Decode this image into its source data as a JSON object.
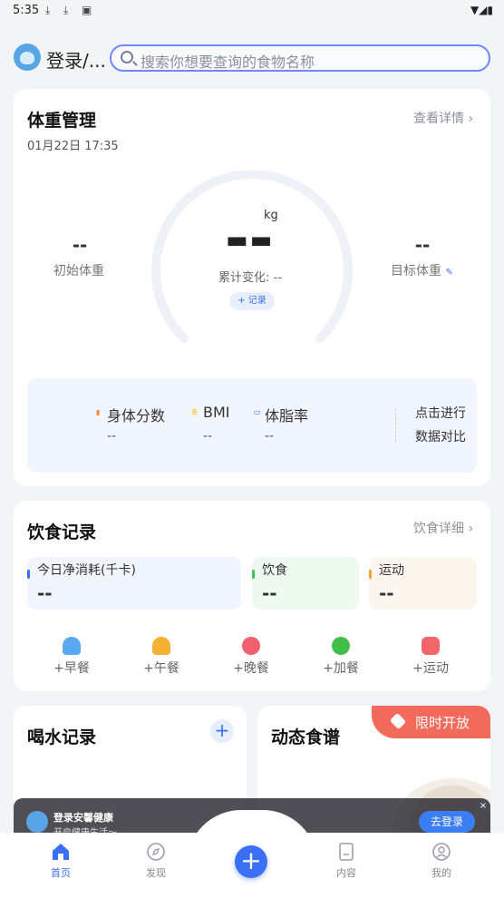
{
  "status_bar": {
    "time": "5:35"
  },
  "header": {
    "login_label": "登录/...",
    "search_placeholder": "搜索你想要查询的食物名称"
  },
  "weight_card": {
    "title": "体重管理",
    "detail_link": "查看详情",
    "date": "01月22日 17:35",
    "initial_value": "--",
    "initial_label": "初始体重",
    "current_value": "▬▬",
    "unit": "kg",
    "cumulative_change": "累计变化: --",
    "record_button": "+ 记录",
    "target_value": "--",
    "target_label": "目标体重",
    "stats": [
      {
        "label": "身体分数",
        "value": "--"
      },
      {
        "label": "BMI",
        "value": "--"
      },
      {
        "label": "体脂率",
        "value": "--"
      }
    ],
    "compare_label": "点击进行数据对比"
  },
  "diet_card": {
    "title": "饮食记录",
    "detail_link": "饮食详细",
    "tiles": [
      {
        "label": "今日净消耗(千卡)",
        "value": "--"
      },
      {
        "label": "饮食",
        "value": "--"
      },
      {
        "label": "运动",
        "value": "--"
      }
    ],
    "meals": [
      {
        "label": "+早餐"
      },
      {
        "label": "+午餐"
      },
      {
        "label": "+晚餐"
      },
      {
        "label": "+加餐"
      },
      {
        "label": "+运动"
      }
    ]
  },
  "water_card": {
    "title": "喝水记录",
    "add_button": "+"
  },
  "recipe_card": {
    "title": "动态食谱",
    "ribbon": "限时开放"
  },
  "login_banner": {
    "title": "登录安馨健康",
    "subtitle": "开启健康生活～",
    "button": "去登录",
    "close": "×"
  },
  "bottom_nav": {
    "items": [
      {
        "label": "首页"
      },
      {
        "label": "发现"
      },
      {
        "label": "内容"
      },
      {
        "label": "我的"
      }
    ],
    "center": "+"
  },
  "colors": {
    "accent": "#3b6ff5",
    "ribbon": "#f26a5b",
    "tile_blue": "#f1f5fd",
    "tile_green": "#eefaf0",
    "tile_orange": "#fdf6ef"
  }
}
